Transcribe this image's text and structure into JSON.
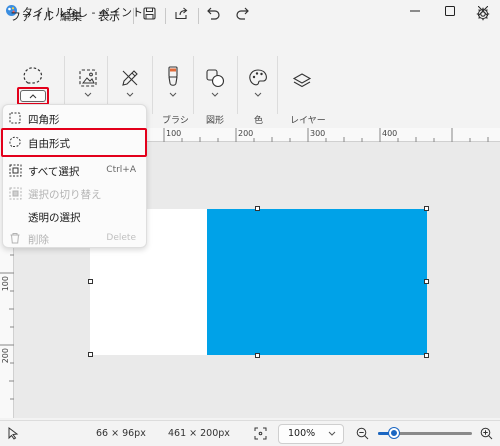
{
  "window": {
    "title": "タイトルなし - ペイント"
  },
  "menu": {
    "file": "ファイル",
    "edit": "編集",
    "view": "表示"
  },
  "toolbar": {
    "brush_label": "ブラシ",
    "shapes_label": "図形",
    "color_label": "色",
    "layers_label": "レイヤー"
  },
  "dropdown": {
    "items": [
      {
        "label": "四角形",
        "shortcut": "",
        "icon": "rectangle-select-icon",
        "enabled": true
      },
      {
        "label": "自由形式",
        "shortcut": "",
        "icon": "freeform-select-icon",
        "enabled": true,
        "highlighted": true
      },
      {
        "label": "すべて選択",
        "shortcut": "Ctrl+A",
        "icon": "select-all-icon",
        "enabled": true
      },
      {
        "label": "選択の切り替え",
        "shortcut": "",
        "icon": "invert-selection-icon",
        "enabled": false
      },
      {
        "label": "透明の選択",
        "shortcut": "",
        "icon": "",
        "enabled": true
      },
      {
        "label": "削除",
        "shortcut": "Delete",
        "icon": "trash-icon",
        "enabled": false
      }
    ]
  },
  "ruler": {
    "top_labels": [
      "100",
      "200",
      "300",
      "400"
    ],
    "left_labels": [
      "100",
      "200"
    ]
  },
  "canvas": {
    "fill_color": "#00a2e8"
  },
  "status": {
    "selection_size": "66 × 96px",
    "canvas_size": "461 × 200px",
    "zoom": "100%",
    "zoom_level": 0.17
  },
  "colors": {
    "accent": "#1a66c2",
    "highlight": "#e3001b"
  }
}
